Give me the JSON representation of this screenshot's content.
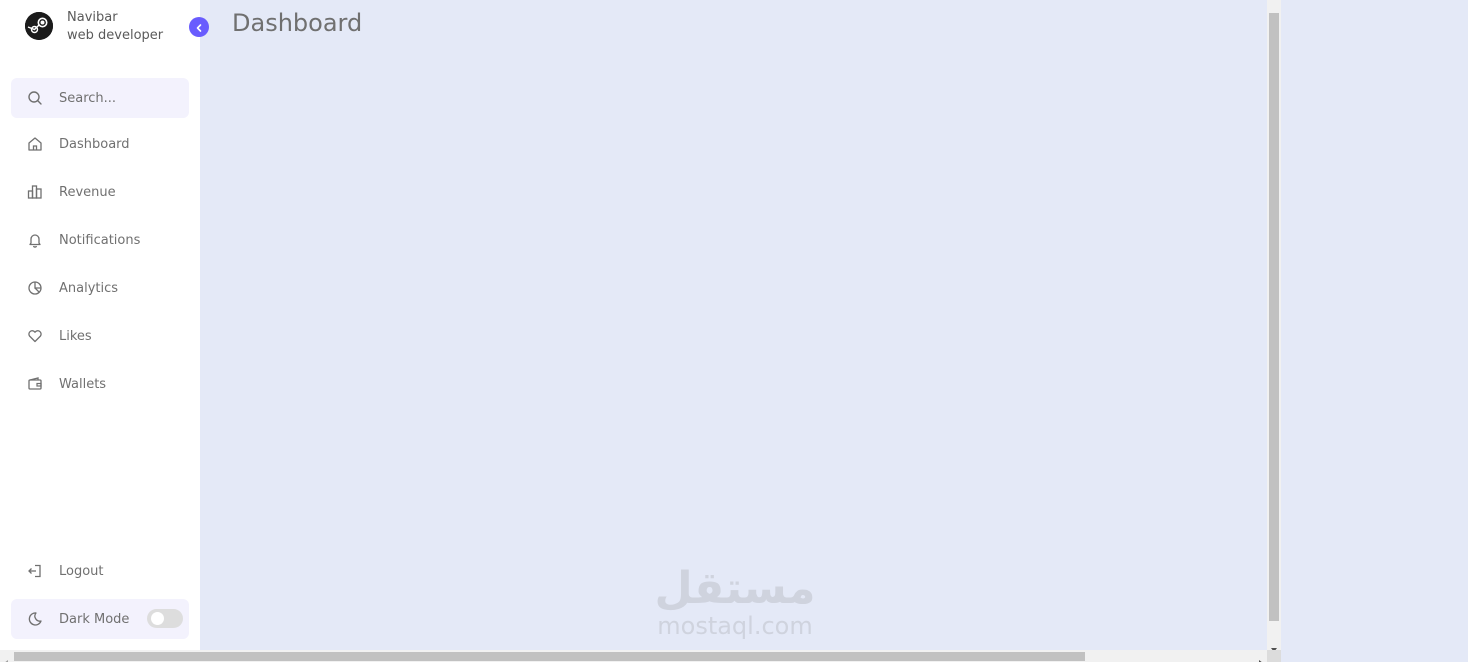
{
  "brand": {
    "name": "Navibar",
    "role": "web developer",
    "logo_icon": "steam-logo-icon"
  },
  "search": {
    "placeholder": "Search..."
  },
  "menu": {
    "items": [
      {
        "label": "Dashboard",
        "icon": "home-icon"
      },
      {
        "label": "Revenue",
        "icon": "bar-chart-icon"
      },
      {
        "label": "Notifications",
        "icon": "bell-icon"
      },
      {
        "label": "Analytics",
        "icon": "pie-chart-icon"
      },
      {
        "label": "Likes",
        "icon": "heart-icon"
      },
      {
        "label": "Wallets",
        "icon": "wallet-icon"
      }
    ]
  },
  "bottom": {
    "logout_label": "Logout",
    "dark_mode_label": "Dark Mode",
    "dark_mode_on": false
  },
  "main": {
    "title": "Dashboard"
  },
  "watermark": {
    "arabic": "مستقل",
    "latin": "mostaql.com"
  },
  "colors": {
    "accent": "#695cfe",
    "background": "#e4e9f7",
    "sidebar": "#ffffff",
    "text": "#707070"
  }
}
